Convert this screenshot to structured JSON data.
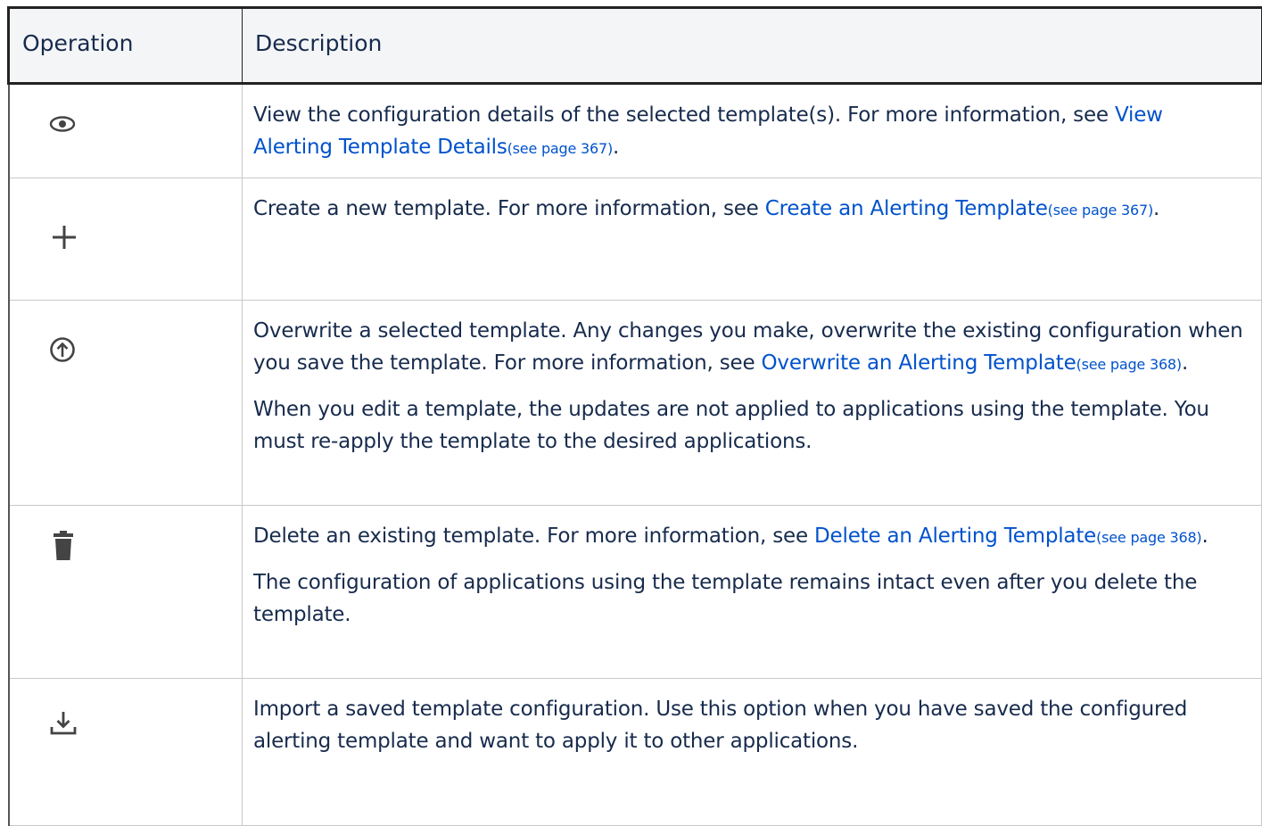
{
  "table": {
    "headers": {
      "operation": "Operation",
      "description": "Description"
    },
    "rows": [
      {
        "icon": "eye-icon",
        "p1_text": "View the configuration details of the selected template(s). For more information, see ",
        "p1_link": "View Alerting Template Details",
        "p1_ref": "(see page 367)",
        "p1_end": "."
      },
      {
        "icon": "plus-icon",
        "p1_text": "Create a new template. For more information, see ",
        "p1_link": "Create an Alerting Template",
        "p1_ref": "(see page 367)",
        "p1_end": "."
      },
      {
        "icon": "upload-circle-icon",
        "p1_text": "Overwrite a selected template. Any changes you make, overwrite the existing configuration when you save the template. For more information, see ",
        "p1_link": "Overwrite an Alerting Template",
        "p1_ref": "(see page 368)",
        "p1_end": ".",
        "p2_text": "When you edit a template, the updates are not applied to applications using the template. You must re-apply the template to the desired applications."
      },
      {
        "icon": "trash-icon",
        "p1_text": "Delete an existing template. For more information, see ",
        "p1_link": "Delete an Alerting Template",
        "p1_ref": "(see page 368)",
        "p1_end": ".",
        "p2_text": "The configuration of applications using the template remains intact even after you delete the template."
      },
      {
        "icon": "download-icon",
        "p1_text": "Import a saved template configuration. Use this option when you have saved the configured alerting template and want to apply it to other applications."
      }
    ]
  },
  "colors": {
    "link": "#0052cc",
    "header_bg": "#f4f5f7",
    "icon": "#444444"
  }
}
